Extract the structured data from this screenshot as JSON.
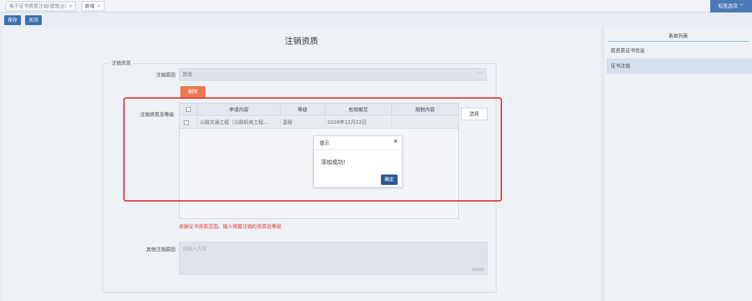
{
  "tabs": [
    {
      "label": "电子证书资质注销(建筑业)",
      "close": "×"
    },
    {
      "label": "新增",
      "close": "×"
    }
  ],
  "tab_options": {
    "label": "标签选项 ﹀"
  },
  "toolbar": {
    "save_label": "保存",
    "close_label": "关闭"
  },
  "page": {
    "title": "注销资质"
  },
  "form": {
    "legend": "注销资质",
    "reason_label": "注销原因",
    "reason_value": "其他",
    "delete_label": "删除",
    "quals_label": "注销资质及等级",
    "choose_label": "选择",
    "columns": [
      "申请内容",
      "等级",
      "有效期至",
      "限制内容"
    ],
    "rows": [
      {
        "content": "公路交通工程（公路机电工程...",
        "grade": "壹级",
        "expiry": "2028年12月22日",
        "limit": ""
      }
    ],
    "hint": "依据证书资质范围，输入需要注销的资质及等级",
    "other_reason_label": "其他注销原因",
    "other_reason_placeholder": "请输入内容",
    "counter": "0/500"
  },
  "dialog": {
    "title": "提示",
    "close": "×",
    "message": "添加成功!",
    "ok_label": "确定"
  },
  "sidebar": {
    "title": "表单列表",
    "items": [
      {
        "label": "原资质证书信息"
      },
      {
        "label": "证书注销"
      }
    ]
  },
  "colors": {
    "accent": "#3e6fae",
    "delete": "#e87a4e",
    "highlight": "#e53935"
  }
}
